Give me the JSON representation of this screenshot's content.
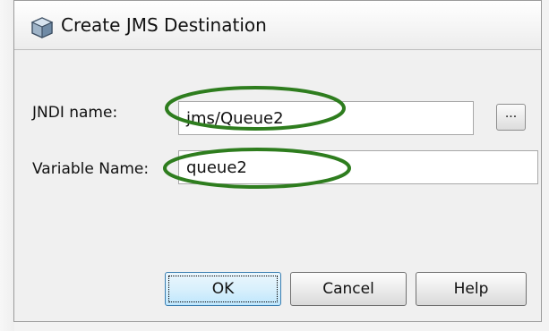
{
  "window": {
    "title": "Create JMS Destination"
  },
  "form": {
    "jndi_label": "JNDI name:",
    "jndi_value": "jms/Queue2",
    "browse_label": "...",
    "variable_label": "Variable Name:",
    "variable_value": "queue2"
  },
  "buttons": {
    "ok": "OK",
    "cancel": "Cancel",
    "help": "Help"
  },
  "colors": {
    "highlight_oval": "#2e7d1e",
    "default_button_border": "#3c7fb1"
  },
  "icons": {
    "title": "jms-cube-icon"
  }
}
